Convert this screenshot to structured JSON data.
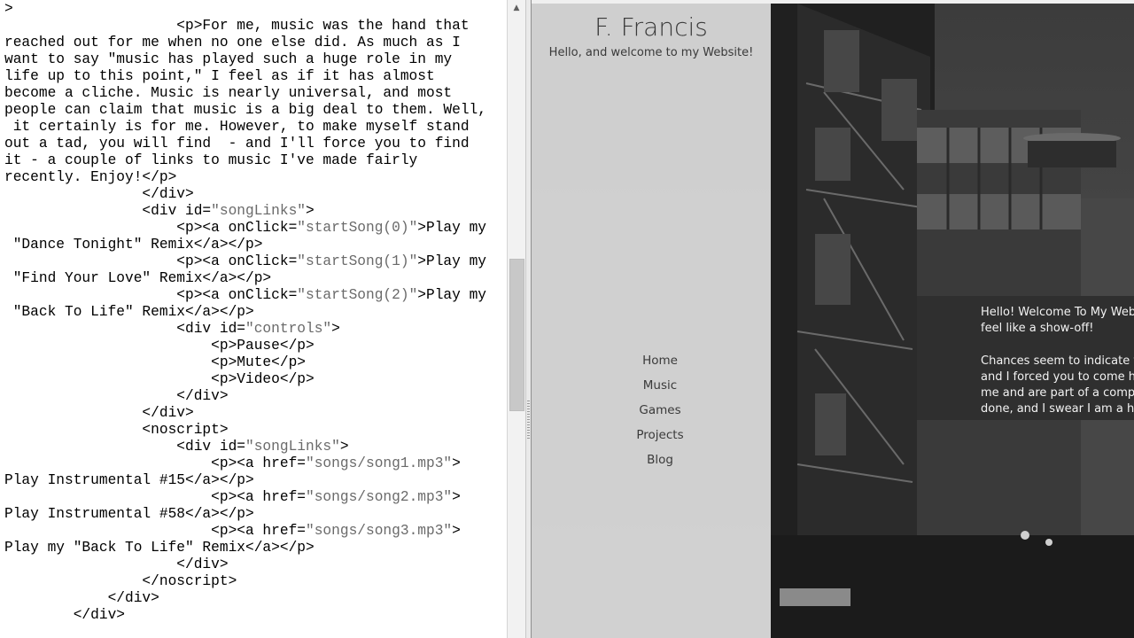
{
  "editor": {
    "lines": [
      [
        {
          "t": ">"
        }
      ],
      [
        {
          "t": "                    <p>For me, music was the hand that"
        }
      ],
      [
        {
          "t": "reached out for me when no one else did. As much as I"
        }
      ],
      [
        {
          "t": "want to say \"music has played such a huge role in my"
        }
      ],
      [
        {
          "t": "life up to this point,\" I feel as if it has almost"
        }
      ],
      [
        {
          "t": "become a cliche. Music is nearly universal, and most"
        }
      ],
      [
        {
          "t": "people can claim that music is a big deal to them. Well,"
        }
      ],
      [
        {
          "t": " it certainly is for me. However, to make myself stand"
        }
      ],
      [
        {
          "t": "out a tad, you will find  - and I'll force you to find"
        }
      ],
      [
        {
          "t": "it - a couple of links to music I've made fairly"
        }
      ],
      [
        {
          "t": "recently. Enjoy!</p>"
        }
      ],
      [
        {
          "t": "                </div>"
        }
      ],
      [
        {
          "t": "                <div id="
        },
        {
          "t": "\"songLinks\"",
          "s": 1
        },
        {
          "t": ">"
        }
      ],
      [
        {
          "t": "                    <p><a onClick="
        },
        {
          "t": "\"startSong(0)\"",
          "s": 1
        },
        {
          "t": ">Play my"
        }
      ],
      [
        {
          "t": " \"Dance Tonight\" Remix</a></p>"
        }
      ],
      [
        {
          "t": "                    <p><a onClick="
        },
        {
          "t": "\"startSong(1)\"",
          "s": 1
        },
        {
          "t": ">Play my"
        }
      ],
      [
        {
          "t": " \"Find Your Love\" Remix</a></p>"
        }
      ],
      [
        {
          "t": "                    <p><a onClick="
        },
        {
          "t": "\"startSong(2)\"",
          "s": 1
        },
        {
          "t": ">Play my"
        }
      ],
      [
        {
          "t": " \"Back To Life\" Remix</a></p>"
        }
      ],
      [
        {
          "t": "                    <div id="
        },
        {
          "t": "\"controls\"",
          "s": 1
        },
        {
          "t": ">"
        }
      ],
      [
        {
          "t": "                        <p>Pause</p>"
        }
      ],
      [
        {
          "t": "                        <p>Mute</p>"
        }
      ],
      [
        {
          "t": "                        <p>Video</p>"
        }
      ],
      [
        {
          "t": "                    </div>"
        }
      ],
      [
        {
          "t": "                </div>"
        }
      ],
      [
        {
          "t": "                <noscript>"
        }
      ],
      [
        {
          "t": "                    <div id="
        },
        {
          "t": "\"songLinks\"",
          "s": 1
        },
        {
          "t": ">"
        }
      ],
      [
        {
          "t": "                        <p><a href="
        },
        {
          "t": "\"songs/song1.mp3\"",
          "s": 1
        },
        {
          "t": ">"
        }
      ],
      [
        {
          "t": "Play Instrumental #15</a></p>"
        }
      ],
      [
        {
          "t": "                        <p><a href="
        },
        {
          "t": "\"songs/song2.mp3\"",
          "s": 1
        },
        {
          "t": ">"
        }
      ],
      [
        {
          "t": "Play Instrumental #58</a></p>"
        }
      ],
      [
        {
          "t": "                        <p><a href="
        },
        {
          "t": "\"songs/song3.mp3\"",
          "s": 1
        },
        {
          "t": ">"
        }
      ],
      [
        {
          "t": "Play my \"Back To Life\" Remix</a></p>"
        }
      ],
      [
        {
          "t": "                    </div>"
        }
      ],
      [
        {
          "t": "                </noscript>"
        }
      ],
      [
        {
          "t": "            </div>"
        }
      ],
      [
        {
          "t": "        </div>"
        }
      ]
    ]
  },
  "scrollbar": {
    "up_arrow_icon": "▲"
  },
  "preview": {
    "site_title": "F. Francis",
    "site_subtitle": "Hello, and welcome to my Website!",
    "nav": [
      {
        "label": "Home",
        "name": "nav-home"
      },
      {
        "label": "Music",
        "name": "nav-music"
      },
      {
        "label": "Games",
        "name": "nav-games"
      },
      {
        "label": "Projects",
        "name": "nav-projects"
      },
      {
        "label": "Blog",
        "name": "nav-blog"
      }
    ],
    "welcome": {
      "p1": [
        "Hello! Welcome To My Webs",
        "feel like a show-off!"
      ],
      "p2": [
        "Chances seem to indicate tha",
        "and I forced you to come he",
        "me and are part of a compa",
        "done, and I swear I am a har"
      ]
    }
  },
  "colors": {
    "string": "#6a6a6a",
    "panel": "#dadada",
    "photo_dark": "#2a2a2a"
  }
}
